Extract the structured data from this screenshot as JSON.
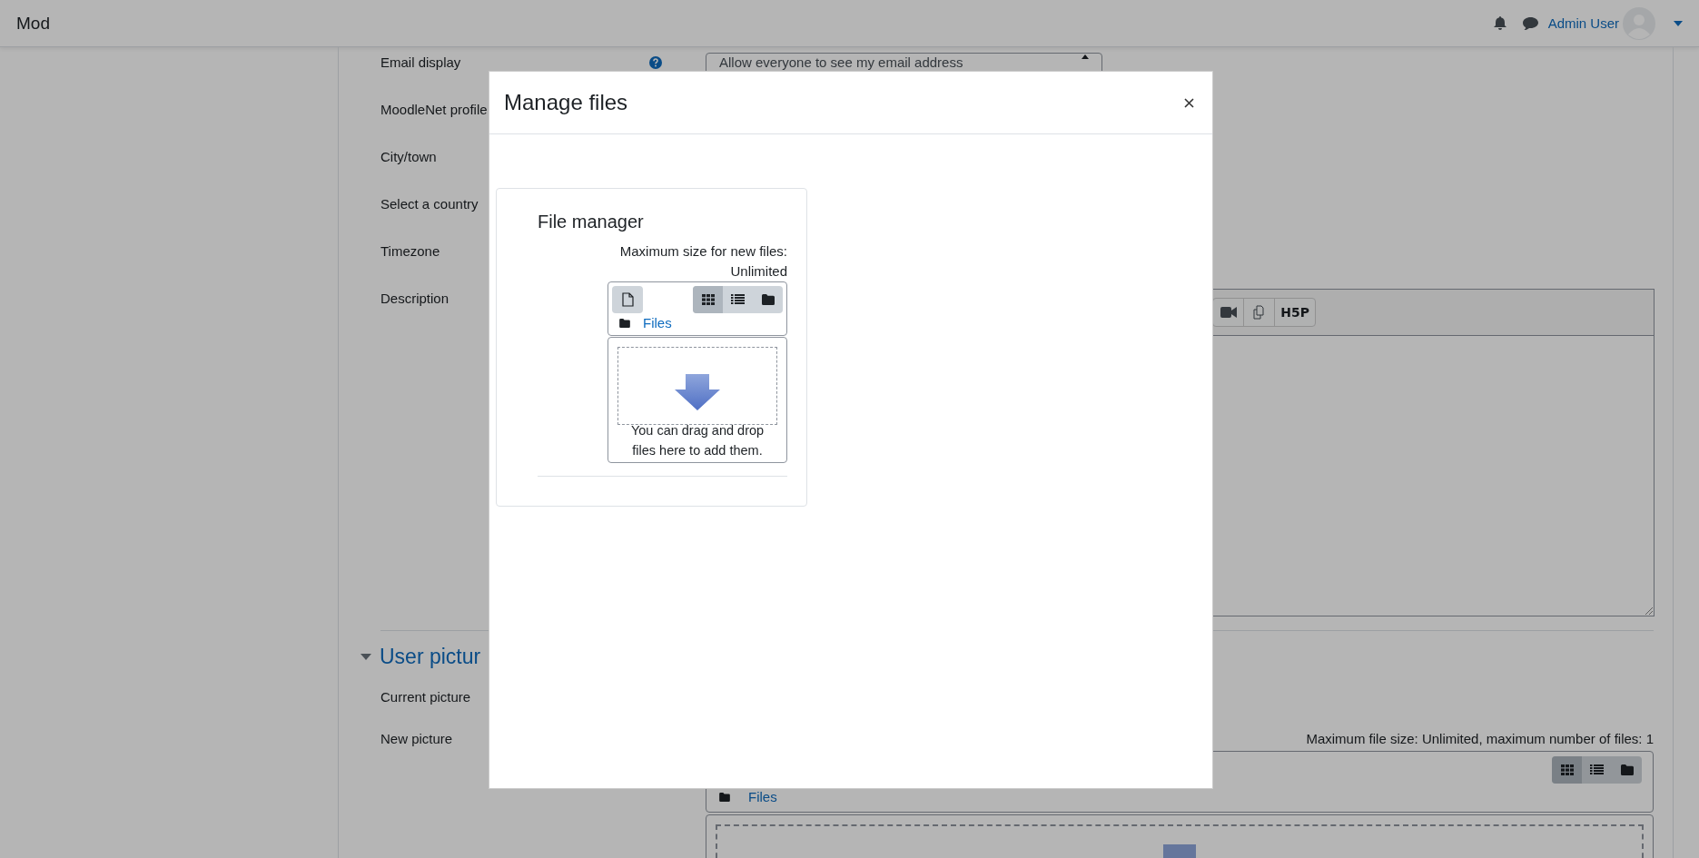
{
  "navbar": {
    "brand": "Mod",
    "user_name": "Admin User"
  },
  "form": {
    "fields": [
      {
        "label": "Email display",
        "help": true,
        "kind": "select",
        "value": "Allow everyone to see my email address"
      },
      {
        "label": "MoodleNet profile",
        "help": false
      },
      {
        "label": "City/town",
        "help": false
      },
      {
        "label": "Select a country",
        "help": false
      },
      {
        "label": "Timezone",
        "help": false
      },
      {
        "label": "Description",
        "help": false,
        "kind": "editor",
        "toolbar": [
          {
            "kind": "video"
          },
          {
            "kind": "copy"
          },
          {
            "kind": "h5p",
            "label": "H5P"
          }
        ]
      }
    ]
  },
  "section": {
    "title": "User pictur",
    "expanded": true,
    "fields": [
      {
        "label": "Current picture"
      },
      {
        "label": "New picture",
        "kind": "filepicker",
        "limits": "Maximum file size: Unlimited, maximum number of files: 1",
        "path": "Files",
        "views": [
          {
            "kind": "icons",
            "selected": true
          },
          {
            "kind": "list",
            "selected": false
          },
          {
            "kind": "tree",
            "selected": false
          }
        ]
      }
    ]
  },
  "modal": {
    "title": "Manage files",
    "file_manager": {
      "title": "File manager",
      "max_size_label": "Maximum size for new files:",
      "max_size_value": "Unlimited",
      "path": "Files",
      "views": [
        {
          "kind": "icons",
          "selected": true
        },
        {
          "kind": "list",
          "selected": false
        },
        {
          "kind": "tree",
          "selected": false
        }
      ],
      "drop_hint": "You can drag and drop files here to add them."
    }
  }
}
